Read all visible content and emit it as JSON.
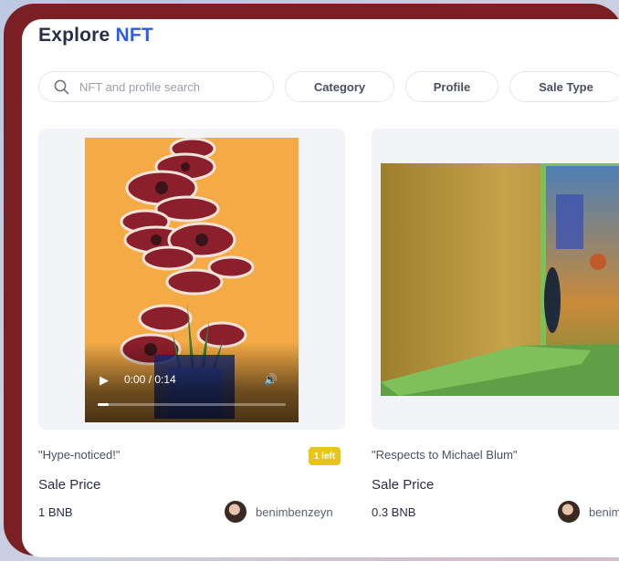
{
  "page": {
    "title_prefix": "Explore",
    "title_accent": "NFT"
  },
  "search": {
    "placeholder": "NFT and profile search"
  },
  "filters": [
    {
      "label": "Category"
    },
    {
      "label": "Profile"
    },
    {
      "label": "Sale Type"
    }
  ],
  "cards": [
    {
      "name": "\"Hype-noticed!\"",
      "badge": "1 left",
      "sale_label": "Sale Price",
      "price": "1 BNB",
      "creator": "benimbenzeyn",
      "video": {
        "time": "0:00 / 0:14",
        "progress": 0.06
      }
    },
    {
      "name": "\"Respects to Michael Blum\"",
      "sale_label": "Sale Price",
      "price": "0.3 BNB",
      "creator": "benimbenzeyn"
    }
  ],
  "colors": {
    "frame": "#7a1f24",
    "accent": "#2f5de0",
    "badge": "#e8c51c",
    "art1_background": "#f4ab45"
  }
}
